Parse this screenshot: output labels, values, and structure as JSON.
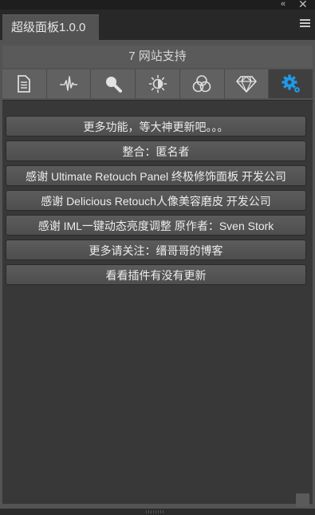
{
  "window": {
    "collapse_glyph": "«",
    "close_glyph": "✕"
  },
  "panel": {
    "tab_title": "超级面板1.0.0",
    "menu_icon": "hamburger-menu-icon"
  },
  "site_support": "7 网站支持",
  "toolbar": {
    "tabs": [
      {
        "icon": "document-icon",
        "active": false
      },
      {
        "icon": "pulse-wave-icon",
        "active": false
      },
      {
        "icon": "magnifier-icon",
        "active": false
      },
      {
        "icon": "brightness-icon",
        "active": false
      },
      {
        "icon": "rgb-circles-icon",
        "active": false
      },
      {
        "icon": "diamond-icon",
        "active": false
      },
      {
        "icon": "settings-gear-icon",
        "active": true
      }
    ],
    "active_color": "#1e9be8"
  },
  "buttons": [
    {
      "label": "更多功能，等大神更新吧。。。"
    },
    {
      "label": "整合：匿名者"
    },
    {
      "label": "感谢 Ultimate Retouch Panel 终极修饰面板 开发公司"
    },
    {
      "label": "感谢 Delicious Retouch人像美容磨皮 开发公司"
    },
    {
      "label": "感谢 IML一键动态亮度调整 原作者：Sven Stork"
    },
    {
      "label": "更多请关注：缙哥哥的博客"
    },
    {
      "label": "看看插件有没有更新"
    }
  ]
}
